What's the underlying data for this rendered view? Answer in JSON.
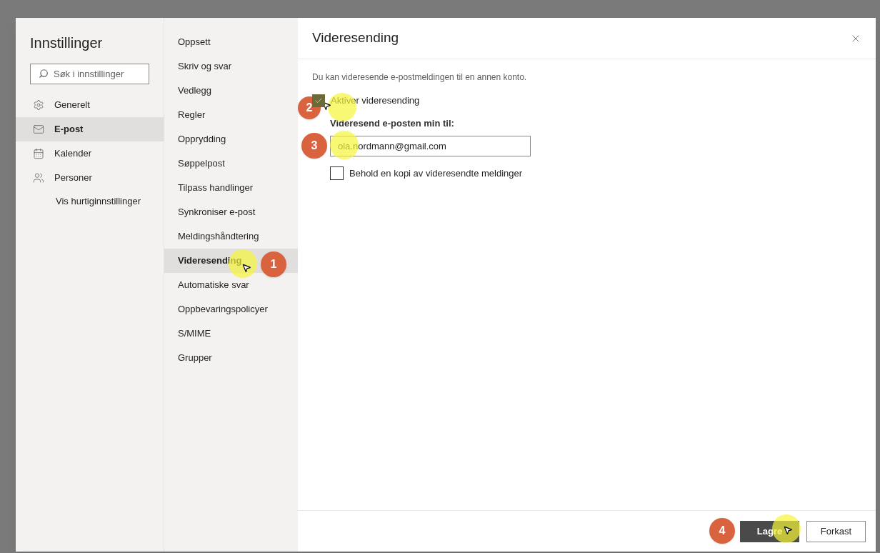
{
  "settings_nav": {
    "title": "Innstillinger",
    "search": {
      "placeholder": "Søk i innstillinger"
    },
    "items": [
      {
        "label": "Generelt",
        "selected": false
      },
      {
        "label": "E-post",
        "selected": true
      },
      {
        "label": "Kalender",
        "selected": false
      },
      {
        "label": "Personer",
        "selected": false
      }
    ],
    "quick_settings_link": "Vis hurtiginnstillinger"
  },
  "subnav": {
    "items": [
      {
        "label": "Oppsett",
        "selected": false
      },
      {
        "label": "Skriv og svar",
        "selected": false
      },
      {
        "label": "Vedlegg",
        "selected": false
      },
      {
        "label": "Regler",
        "selected": false
      },
      {
        "label": "Opprydding",
        "selected": false
      },
      {
        "label": "Søppelpost",
        "selected": false
      },
      {
        "label": "Tilpass handlinger",
        "selected": false
      },
      {
        "label": "Synkroniser e-post",
        "selected": false
      },
      {
        "label": "Meldingshåndtering",
        "selected": false
      },
      {
        "label": "Videresending",
        "selected": true
      },
      {
        "label": "Automatiske svar",
        "selected": false
      },
      {
        "label": "Oppbevaringspolicyer",
        "selected": false
      },
      {
        "label": "S/MIME",
        "selected": false
      },
      {
        "label": "Grupper",
        "selected": false
      }
    ]
  },
  "panel": {
    "title": "Videresending",
    "description": "Du kan videresende e-postmeldingen til en annen konto.",
    "enable_forwarding": {
      "label": "Aktiver videresending",
      "checked": true
    },
    "forward_to_label": "Videresend e-posten min til:",
    "forward_to_value": "ola.nordmann@gmail.com",
    "keep_copy": {
      "label": "Behold en kopi av videresendte meldinger",
      "checked": false
    },
    "buttons": [
      {
        "label": "Lagre",
        "kind": "primary"
      },
      {
        "label": "Forkast",
        "kind": "secondary"
      }
    ]
  },
  "step_markers": [
    {
      "number": "1"
    },
    {
      "number": "2"
    },
    {
      "number": "3"
    },
    {
      "number": "4"
    }
  ]
}
